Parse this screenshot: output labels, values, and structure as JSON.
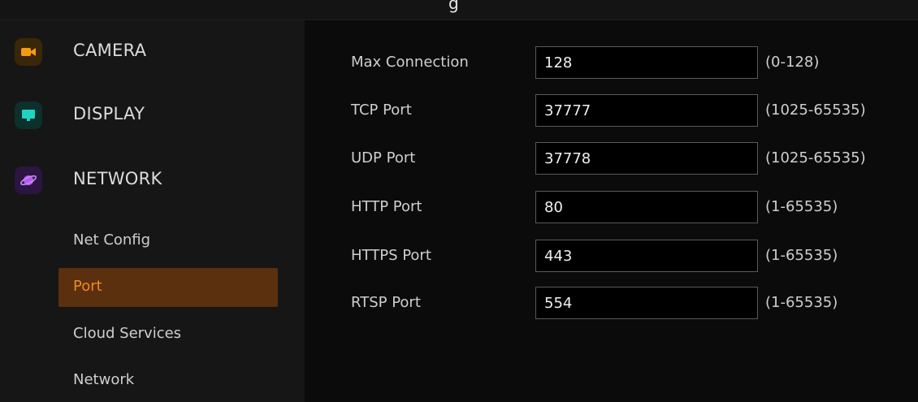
{
  "header": {
    "partial_text": "g"
  },
  "sidebar": {
    "categories": [
      {
        "label": "CAMERA",
        "icon": "camera-icon",
        "color": "#f39c12"
      },
      {
        "label": "DISPLAY",
        "icon": "monitor-icon",
        "color": "#1fd3c0"
      },
      {
        "label": "NETWORK",
        "icon": "planet-icon",
        "color": "#b55cf2"
      }
    ],
    "network_items": [
      {
        "label": "Net Config"
      },
      {
        "label": "Port",
        "active": true
      },
      {
        "label": "Cloud Services"
      },
      {
        "label": "Network"
      }
    ]
  },
  "port_settings": {
    "rows": [
      {
        "label": "Max Connection",
        "value": "128",
        "range": "(0-128)"
      },
      {
        "label": "TCP Port",
        "value": "37777",
        "range": "(1025-65535)"
      },
      {
        "label": "UDP Port",
        "value": "37778",
        "range": "(1025-65535)"
      },
      {
        "label": "HTTP Port",
        "value": "80",
        "range": "(1-65535)"
      },
      {
        "label": "HTTPS Port",
        "value": "443",
        "range": "(1-65535)"
      },
      {
        "label": "RTSP Port",
        "value": "554",
        "range": "(1-65535)"
      }
    ]
  },
  "colors": {
    "accent": "#f08a1e",
    "active_bg": "#5a300e"
  }
}
